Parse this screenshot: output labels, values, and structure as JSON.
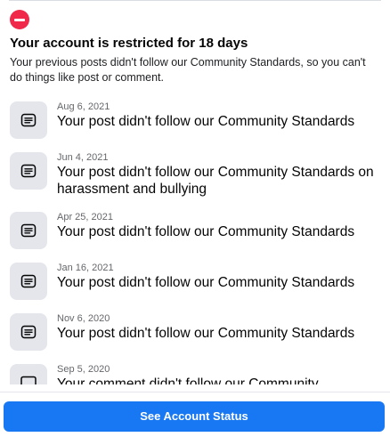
{
  "restriction": {
    "icon": "restricted-icon",
    "title": "Your account is restricted for 18 days",
    "description": "Your previous posts didn't follow our Community Standards, so you can't do things like post or comment."
  },
  "violations": [
    {
      "date": "Aug 6, 2021",
      "text": "Your post didn't follow our Community Standards",
      "icon": "post-icon"
    },
    {
      "date": "Jun 4, 2021",
      "text": "Your post didn't follow our Community Standards on harassment and bullying",
      "icon": "post-icon"
    },
    {
      "date": "Apr 25, 2021",
      "text": "Your post didn't follow our Community Standards",
      "icon": "post-icon"
    },
    {
      "date": "Jan 16, 2021",
      "text": "Your post didn't follow our Community Standards",
      "icon": "post-icon"
    },
    {
      "date": "Nov 6, 2020",
      "text": "Your post didn't follow our Community Standards",
      "icon": "post-icon"
    },
    {
      "date": "Sep 5, 2020",
      "text": "Your comment didn't follow our Community",
      "icon": "comment-icon"
    }
  ],
  "actions": {
    "see_account_status": "See Account Status"
  },
  "colors": {
    "primary": "#1877f2",
    "restricted": "#f02849",
    "icon_bg": "#e4e6eb",
    "secondary_text": "#65676b"
  }
}
